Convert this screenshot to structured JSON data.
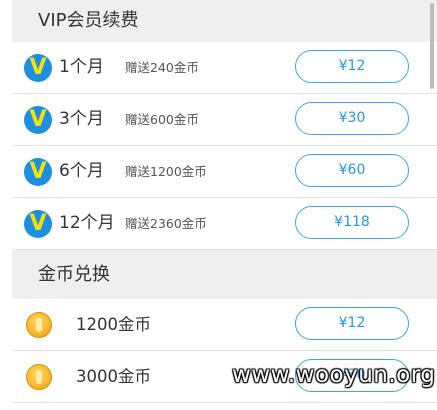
{
  "vip_section": {
    "title": "VIP会员续费",
    "plans": [
      {
        "icon": "vip-v-icon",
        "duration": "1个月",
        "gift": "赠送240金币",
        "price": "¥12"
      },
      {
        "icon": "vip-v-icon",
        "duration": "3个月",
        "gift": "赠送600金币",
        "price": "¥30"
      },
      {
        "icon": "vip-v-icon",
        "duration": "6个月",
        "gift": "赠送1200金币",
        "price": "¥60"
      },
      {
        "icon": "vip-v-icon",
        "duration": "12个月",
        "gift": "赠送2360金币",
        "price": "¥118"
      }
    ]
  },
  "coin_section": {
    "title": "金币兑换",
    "items": [
      {
        "icon": "gold-coin-icon",
        "amount": "1200金币",
        "price": "¥12"
      },
      {
        "icon": "gold-coin-icon",
        "amount": "3000金币",
        "price": "¥30"
      }
    ]
  },
  "watermark": "www.wooyun.org",
  "colors": {
    "accent": "#2196e3",
    "vip_icon_bg": "#1b8fe0",
    "vip_icon_letter": "#f2e011",
    "coin": "#f4b42a",
    "section_bg": "#efefef"
  }
}
